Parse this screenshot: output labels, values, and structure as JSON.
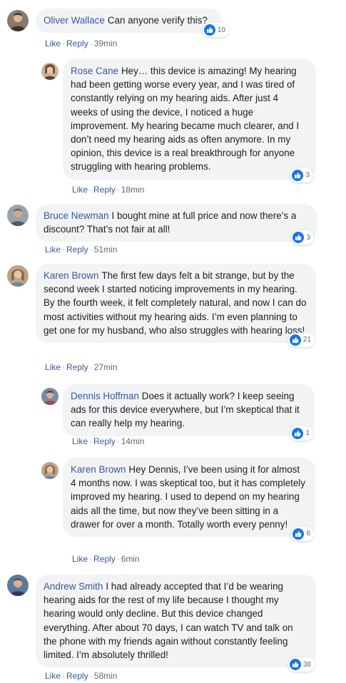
{
  "actions": {
    "like": "Like",
    "reply": "Reply",
    "separator": "·"
  },
  "colors": {
    "author": "#385898",
    "bubble": "#f2f3f5",
    "like_badge": "#1b74e4"
  },
  "comments": [
    {
      "author": "Oliver Wallace",
      "text": "Can anyone verify this?",
      "likes": "10",
      "time": "39min",
      "reply": false,
      "avatar_icon": "profile-photo"
    },
    {
      "author": "Rose Cane",
      "text": "Hey… this device is amazing! My hearing had been getting worse every year, and I was tired of constantly relying on my hearing aids. After just 4 weeks of using the device, I noticed a huge improvement. My hearing became much clearer, and I don’t need my hearing aids as often anymore. In my opinion, this device is a real breakthrough for anyone struggling with hearing problems.",
      "likes": "3",
      "time": "18min",
      "reply": true,
      "avatar_icon": "profile-photo"
    },
    {
      "author": "Bruce Newman",
      "text": "I bought mine at full price and now there’s a discount? That’s not fair at all!",
      "likes": "3",
      "time": "51min",
      "reply": false,
      "avatar_icon": "profile-photo"
    },
    {
      "author": "Karen Brown",
      "text": "The first few days felt a bit strange, but by the second week I started noticing improvements in my hearing. By the fourth week, it felt completely natural, and now I can do most activities without my hearing aids. I’m even planning to get one for my husband, who also struggles with hearing loss!",
      "likes": "21",
      "time": "27min",
      "reply": false,
      "avatar_icon": "profile-photo"
    },
    {
      "author": "Dennis Hoffman",
      "text": "Does it actually work? I keep seeing ads for this device everywhere, but I’m skeptical that it can really help my hearing.",
      "likes": "1",
      "time": "14min",
      "reply": true,
      "avatar_icon": "profile-photo"
    },
    {
      "author": "Karen Brown",
      "text": "Hey Dennis, I’ve been using it for almost 4 months now. I was skeptical too, but it has completely improved my hearing. I used to depend on my hearing aids all the time, but now they’ve been sitting in a drawer for over a month. Totally worth every penny!",
      "likes": "6",
      "time": "6min",
      "reply": true,
      "avatar_icon": "profile-photo"
    },
    {
      "author": "Andrew Smith",
      "text": "I had already accepted that I’d be wearing hearing aids for the rest of my life because I thought my hearing would only decline. But this device changed everything. After about 70 days, I can watch TV and talk on the phone with my friends again without constantly feeling limited. I’m absolutely thrilled!",
      "likes": "38",
      "time": "58min",
      "reply": false,
      "avatar_icon": "profile-photo"
    }
  ]
}
